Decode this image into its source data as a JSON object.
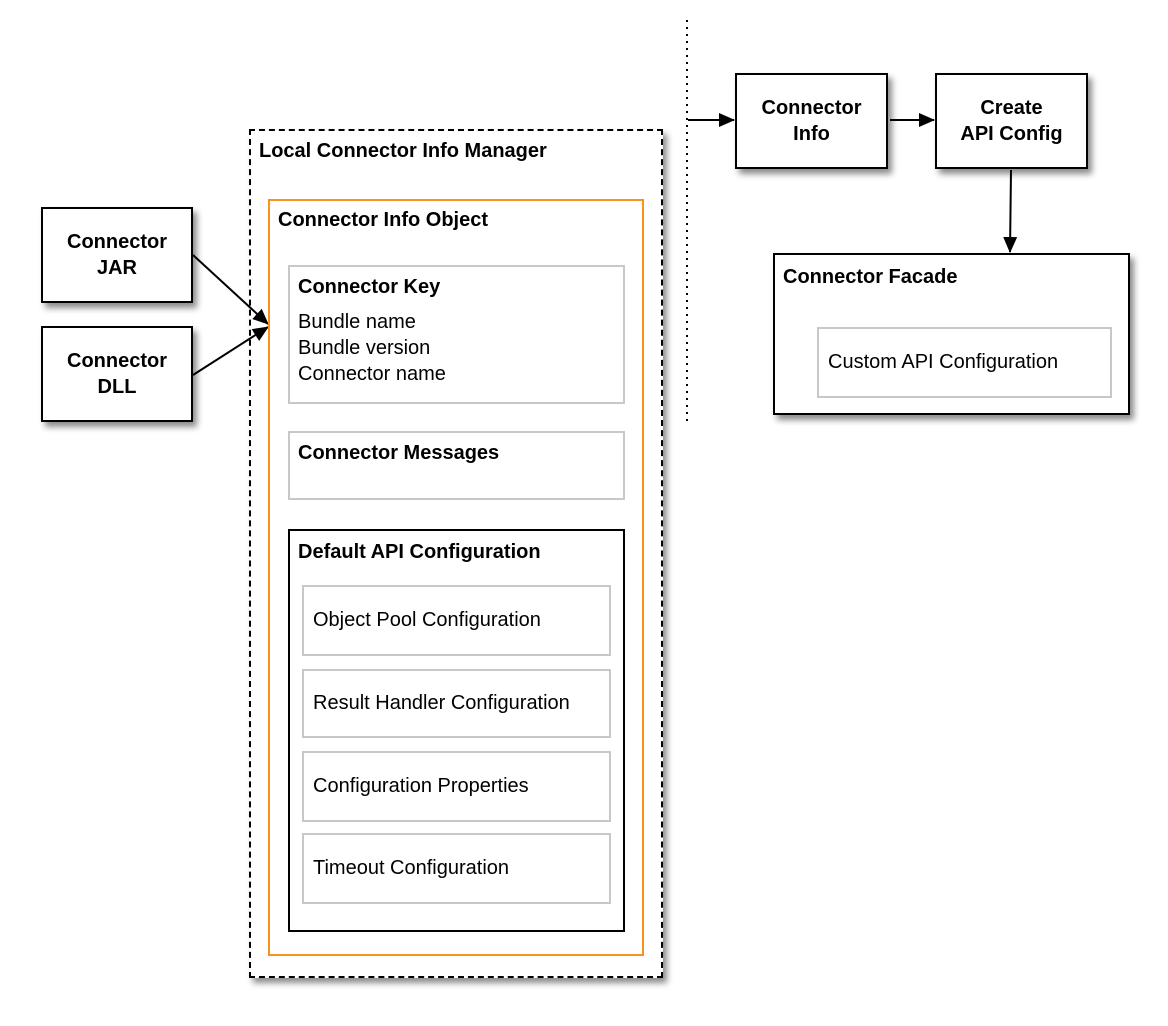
{
  "left_inputs": [
    {
      "line1": "Connector",
      "line2": "JAR"
    },
    {
      "line1": "Connector",
      "line2": "DLL"
    }
  ],
  "manager": {
    "title": "Local Connector Info Manager",
    "info_object": {
      "title": "Connector Info Object",
      "key": {
        "title": "Connector Key",
        "items": [
          "Bundle name",
          "Bundle version",
          "Connector name"
        ]
      },
      "messages": {
        "title": "Connector Messages"
      },
      "default_api": {
        "title": "Default API Configuration",
        "items": [
          "Object Pool Configuration",
          "Result Handler Configuration",
          "Configuration Properties",
          "Timeout Configuration"
        ]
      }
    }
  },
  "flow": {
    "connector_info": {
      "line1": "Connector",
      "line2": "Info"
    },
    "create_api": {
      "line1": "Create",
      "line2": "API Config"
    }
  },
  "facade": {
    "title": "Connector Facade",
    "custom": "Custom API Configuration"
  },
  "colors": {
    "container_border": "#f7941d",
    "inner_border": "#c8c8c8"
  }
}
